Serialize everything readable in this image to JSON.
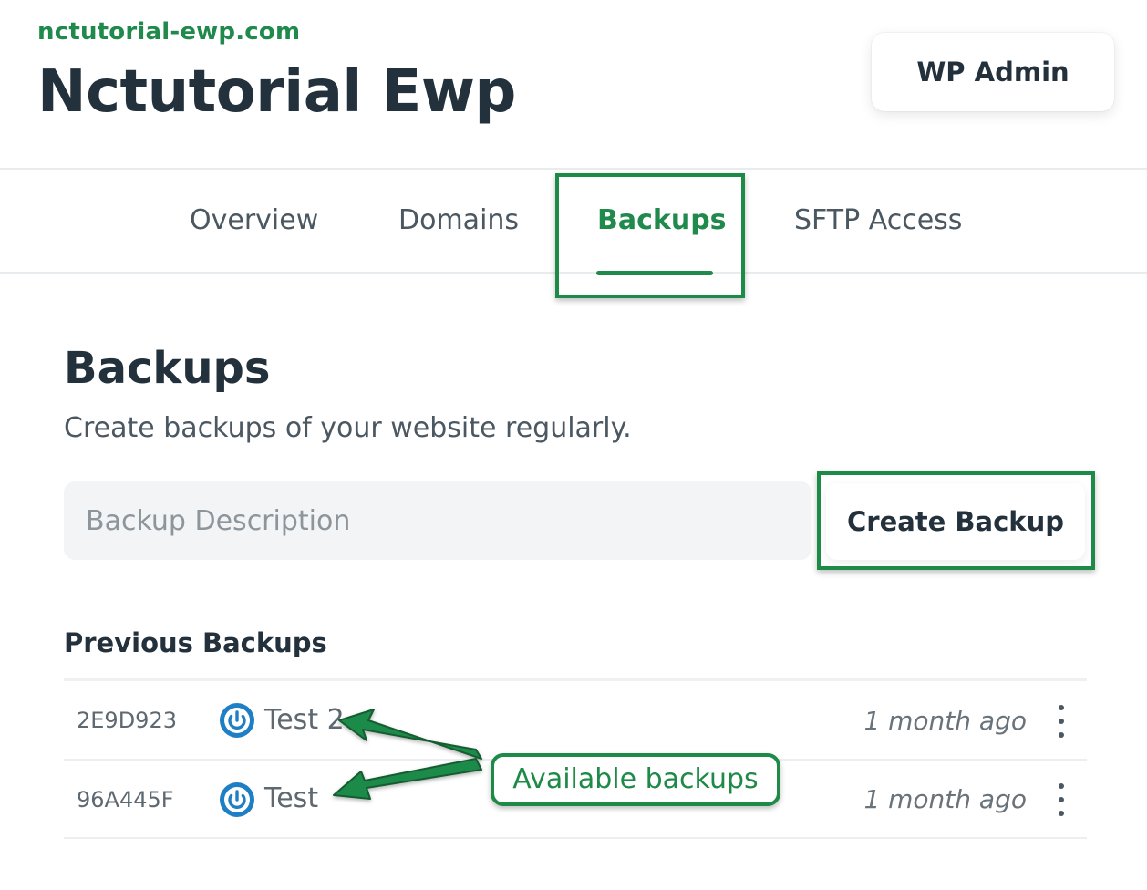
{
  "header": {
    "domain": "nctutorial-ewp.com",
    "title": "Nctutorial Ewp",
    "wp_admin_label": "WP Admin"
  },
  "tabs": [
    {
      "label": "Overview",
      "active": false
    },
    {
      "label": "Domains",
      "active": false
    },
    {
      "label": "Backups",
      "active": true
    },
    {
      "label": "SFTP Access",
      "active": false
    }
  ],
  "backups": {
    "title": "Backups",
    "subtitle": "Create backups of your website regularly.",
    "description_placeholder": "Backup Description",
    "description_value": "",
    "create_label": "Create Backup",
    "previous_title": "Previous Backups",
    "rows": [
      {
        "id": "2E9D923",
        "name": "Test 2",
        "time": "1 month ago",
        "icon": "power-icon"
      },
      {
        "id": "96A445F",
        "name": "Test",
        "time": "1 month ago",
        "icon": "power-icon"
      }
    ]
  },
  "annotation": {
    "callout": "Available backups"
  },
  "colors": {
    "accent": "#1f8a4c",
    "annotation": "#1e8a48",
    "icon_blue": "#1f7fc4",
    "text_dark": "#23313c"
  }
}
